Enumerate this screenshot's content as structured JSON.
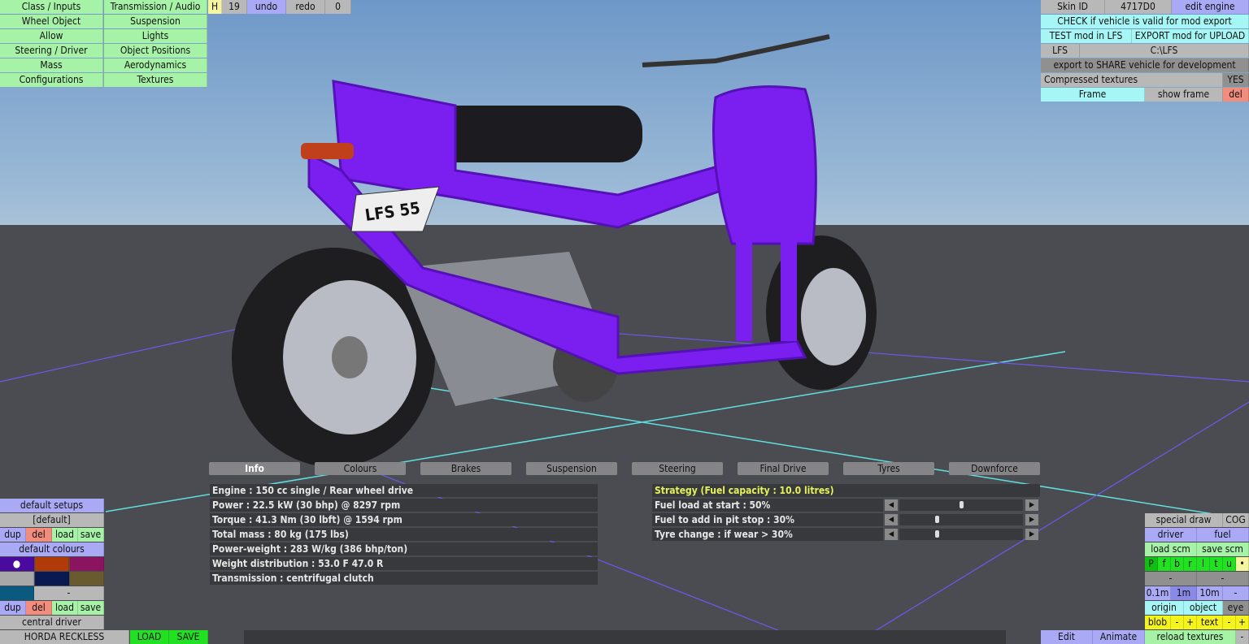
{
  "top_left_menu": [
    [
      "Class / Inputs",
      "Transmission / Audio"
    ],
    [
      "Wheel Object",
      "Suspension"
    ],
    [
      "Allow",
      "Lights"
    ],
    [
      "Steering / Driver",
      "Object Positions"
    ],
    [
      "Mass",
      "Aerodynamics"
    ],
    [
      "Configurations",
      "Textures"
    ]
  ],
  "toolbar": {
    "h": "H",
    "count": "19",
    "undo": "undo",
    "redo": "redo",
    "zero": "0"
  },
  "top_right": {
    "skin_id_label": "Skin ID",
    "skin_id": "4717D0",
    "edit_engine": "edit engine",
    "check": "CHECK if vehicle is valid for mod export",
    "test": "TEST mod in LFS",
    "export": "EXPORT mod for UPLOAD",
    "lfs": "LFS",
    "path": "C:\\LFS",
    "share": "export to SHARE vehicle for development",
    "compressed": "Compressed textures",
    "compressed_val": "YES",
    "frame": "Frame",
    "show_frame": "show frame",
    "del": "del"
  },
  "tabs": [
    "Info",
    "Colours",
    "Brakes",
    "Suspension",
    "Steering",
    "Final Drive",
    "Tyres",
    "Downforce"
  ],
  "info": [
    "Engine : 150 cc single / Rear wheel drive",
    "Power : 22.5 kW (30 bhp) @ 8297 rpm",
    "Torque : 41.3 Nm (30 lbft) @ 1594 rpm",
    "Total mass : 80 kg (175 lbs)",
    "Power-weight : 283 W/kg (386 bhp/ton)",
    "Weight distribution : 53.0 F  47.0 R",
    "Transmission : centrifugal clutch"
  ],
  "strategy": {
    "title": "Strategy (Fuel capacity : 10.0 litres)",
    "sliders": [
      {
        "label": "Fuel load at start : 50%",
        "value": 50
      },
      {
        "label": "Fuel to add in pit stop : 30%",
        "value": 30
      },
      {
        "label": "Tyre change : if wear > 30%",
        "value": 30
      }
    ]
  },
  "bottom_left": {
    "setups": "default setups",
    "setup_name": "[default]",
    "dup": "dup",
    "del": "del",
    "load": "load",
    "save": "save",
    "colours": "default colours",
    "swatches": [
      "#4a0aa0",
      "#b03a08",
      "#8a1460",
      "#a8a8a8",
      "#0a1a50",
      "#6a5a30",
      "#0a5a80"
    ],
    "dash": "-",
    "central_driver": "central driver",
    "car_name": "HORDA RECKLESS",
    "LOAD": "LOAD",
    "SAVE": "SAVE"
  },
  "bottom_right": {
    "special_draw": "special draw",
    "cog": "COG",
    "driver": "driver",
    "fuel": "fuel",
    "load_scm": "load scm",
    "save_scm": "save scm",
    "letters": [
      "P",
      "f",
      "b",
      "r",
      "l",
      "t",
      "u",
      "•"
    ],
    "dash": "-",
    "scale": [
      "0.1m",
      "1m",
      "10m",
      "-"
    ],
    "origin": "origin",
    "object": "object",
    "eye": "eye",
    "blob": "blob",
    "minus": "-",
    "plus": "+",
    "text": "text",
    "reload": "reload textures",
    "edit": "Edit",
    "animate": "Animate"
  },
  "scene": {
    "plate": "LFS 55",
    "body_color": "#7a1ff0"
  }
}
